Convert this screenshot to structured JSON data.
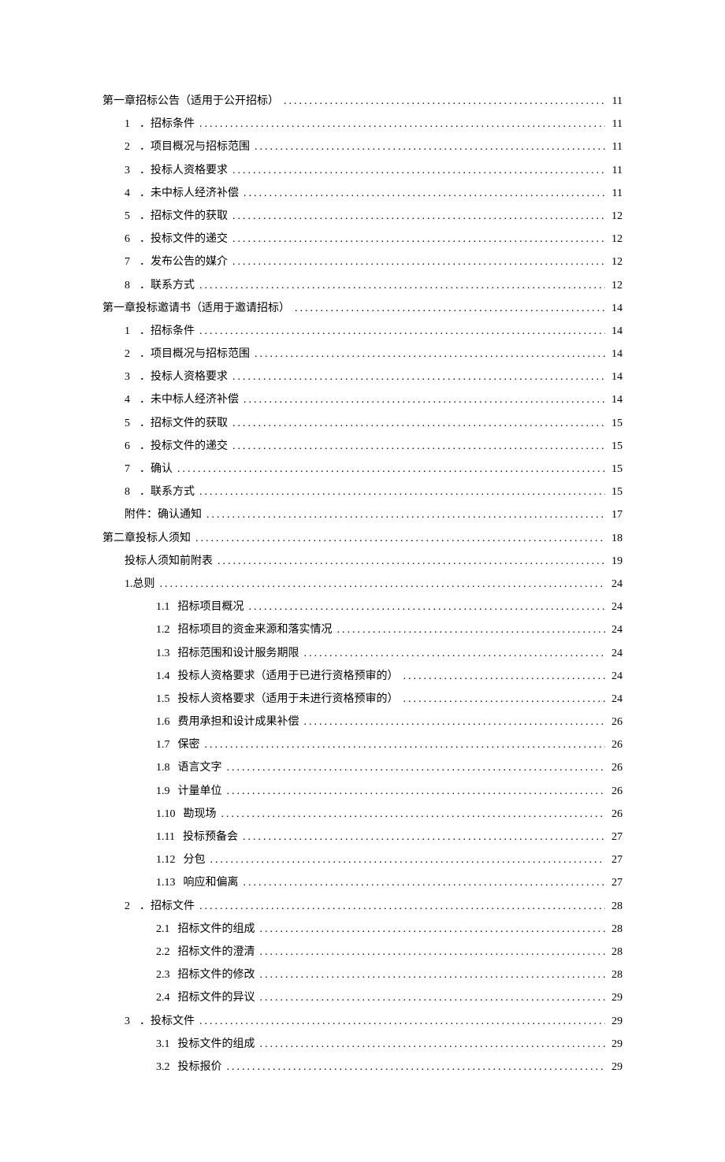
{
  "toc": [
    {
      "level": 0,
      "num": "",
      "label": "第一章招标公告（适用于公开招标）",
      "page": "11"
    },
    {
      "level": 1,
      "num": "1",
      "label": "．招标条件",
      "page": "11"
    },
    {
      "level": 1,
      "num": "2",
      "label": "．项目概况与招标范围",
      "page": "11"
    },
    {
      "level": 1,
      "num": "3",
      "label": "．投标人资格要求",
      "page": "11"
    },
    {
      "level": 1,
      "num": "4",
      "label": "．未中标人经济补偿",
      "page": "11"
    },
    {
      "level": 1,
      "num": "5",
      "label": "．招标文件的获取",
      "page": "12"
    },
    {
      "level": 1,
      "num": "6",
      "label": "．投标文件的递交",
      "page": "12"
    },
    {
      "level": 1,
      "num": "7",
      "label": "．发布公告的媒介",
      "page": "12"
    },
    {
      "level": 1,
      "num": "8",
      "label": "．联系方式",
      "page": "12"
    },
    {
      "level": 0,
      "num": "",
      "label": "第一章投标邀请书（适用于邀请招标）",
      "page": "14"
    },
    {
      "level": 1,
      "num": "1",
      "label": "．招标条件",
      "page": "14"
    },
    {
      "level": 1,
      "num": "2",
      "label": "．项目概况与招标范围",
      "page": "14"
    },
    {
      "level": 1,
      "num": "3",
      "label": "．投标人资格要求",
      "page": "14"
    },
    {
      "level": 1,
      "num": "4",
      "label": "．未中标人经济补偿",
      "page": "14"
    },
    {
      "level": 1,
      "num": "5",
      "label": "．招标文件的获取",
      "page": "15"
    },
    {
      "level": 1,
      "num": "6",
      "label": "．投标文件的递交",
      "page": "15"
    },
    {
      "level": 1,
      "num": "7",
      "label": "．确认",
      "page": "15"
    },
    {
      "level": 1,
      "num": "8",
      "label": "．联系方式",
      "page": "15"
    },
    {
      "level": 1,
      "num": "",
      "label": "附件：确认通知",
      "page": "17"
    },
    {
      "level": 0,
      "num": "",
      "label": "第二章投标人须知",
      "page": "18"
    },
    {
      "level": 1,
      "num": "",
      "label": "投标人须知前附表",
      "page": "19"
    },
    {
      "level": 2,
      "num": "",
      "label": "1.总则",
      "page": "24"
    },
    {
      "level": 3,
      "num": "1.1",
      "label": "招标项目概况",
      "page": "24"
    },
    {
      "level": 3,
      "num": "1.2",
      "label": "招标项目的资金来源和落实情况",
      "page": "24"
    },
    {
      "level": 3,
      "num": "1.3",
      "label": "招标范围和设计服务期限",
      "page": "24"
    },
    {
      "level": 3,
      "num": "1.4",
      "label": "投标人资格要求（适用于已进行资格预审的）",
      "page": "24"
    },
    {
      "level": 3,
      "num": "1.5",
      "label": "投标人资格要求（适用于未进行资格预审的）",
      "page": "24"
    },
    {
      "level": 3,
      "num": "1.6",
      "label": "费用承担和设计成果补偿",
      "page": "26"
    },
    {
      "level": 3,
      "num": "1.7",
      "label": "保密",
      "page": "26"
    },
    {
      "level": 3,
      "num": "1.8",
      "label": "语言文字",
      "page": "26"
    },
    {
      "level": 3,
      "num": "1.9",
      "label": "计量单位",
      "page": "26"
    },
    {
      "level": 3,
      "num": "1.10",
      "label": " 勘现场",
      "page": "26"
    },
    {
      "level": 3,
      "num": "1.11",
      "label": " 投标预备会",
      "page": "27"
    },
    {
      "level": 3,
      "num": "1.12",
      "label": " 分包",
      "page": "27"
    },
    {
      "level": 3,
      "num": "1.13",
      "label": " 响应和偏离",
      "page": "27"
    },
    {
      "level": 1,
      "num": "2",
      "label": "．招标文件",
      "page": "28"
    },
    {
      "level": 3,
      "num": "2.1",
      "label": "招标文件的组成",
      "page": "28"
    },
    {
      "level": 3,
      "num": "2.2",
      "label": "招标文件的澄清",
      "page": "28"
    },
    {
      "level": 3,
      "num": "2.3",
      "label": "招标文件的修改",
      "page": "28"
    },
    {
      "level": 3,
      "num": "2.4",
      "label": "招标文件的异议",
      "page": "29"
    },
    {
      "level": 1,
      "num": "3",
      "label": "．投标文件",
      "page": "29"
    },
    {
      "level": 3,
      "num": "3.1",
      "label": "投标文件的组成",
      "page": "29"
    },
    {
      "level": 3,
      "num": "3.2",
      "label": "投标报价",
      "page": "29"
    }
  ]
}
